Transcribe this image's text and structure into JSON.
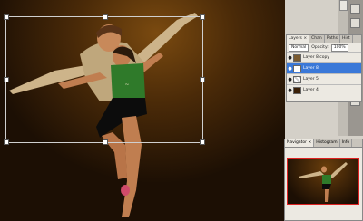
{
  "layers_panel": {
    "tabs": [
      "Layers ×",
      "Chan",
      "Paths",
      "Hist"
    ],
    "blend_mode": "Normal",
    "opacity_label": "Opacity:",
    "opacity_value": "100%",
    "layers": [
      {
        "name": "Layer 8 copy",
        "selected": false
      },
      {
        "name": "Layer 8",
        "selected": true
      },
      {
        "name": "Layer 5",
        "selected": false
      },
      {
        "name": "Layer 4",
        "selected": false
      }
    ]
  },
  "navigator_panel": {
    "tabs": [
      "Navigator ×",
      "Histogram",
      "Info"
    ]
  },
  "colors": {
    "selection": "#3a78d8",
    "view_box": "#dd2222"
  }
}
